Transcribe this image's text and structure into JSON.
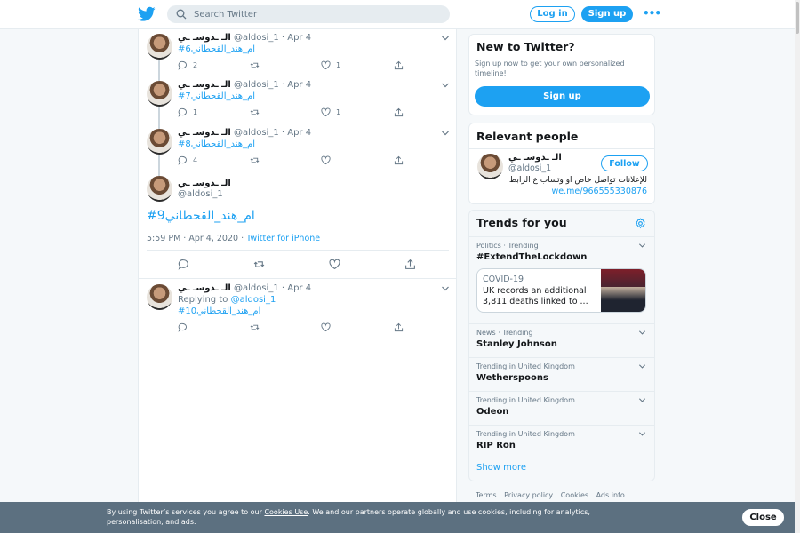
{
  "colors": {
    "brand": "#1da1f2",
    "text": "#14171a",
    "muted": "#657786",
    "border": "#e6ecf0",
    "cookie_bar": "#5c7080"
  },
  "nav": {
    "logo_icon": "twitter-bird-icon",
    "search_placeholder": "Search Twitter",
    "login_label": "Log in",
    "signup_label": "Sign up",
    "more_label": "•••"
  },
  "tweets": [
    {
      "name": "الـ ـدوسـ ـي",
      "handle": "@aldosi_1",
      "date": "Apr 4",
      "text": "#ام_هند_القحطاني6",
      "replies": "2",
      "retweets": "",
      "likes": "1"
    },
    {
      "name": "الـ ـدوسـ ـي",
      "handle": "@aldosi_1",
      "date": "Apr 4",
      "text": "#ام_هند_القحطاني7",
      "replies": "1",
      "retweets": "",
      "likes": "1"
    },
    {
      "name": "الـ ـدوسـ ـي",
      "handle": "@aldosi_1",
      "date": "Apr 4",
      "text": "#ام_هند_القحطاني8",
      "replies": "4",
      "retweets": "",
      "likes": ""
    }
  ],
  "main_tweet": {
    "name": "الـ ـدوسـ ـي",
    "handle": "@aldosi_1",
    "text": "#ام_هند_القحطاني9",
    "time": "5:59 PM · Apr 4, 2020",
    "source": "Twitter for iPhone"
  },
  "reply_tweet": {
    "name": "الـ ـدوسـ ـي",
    "handle": "@aldosi_1",
    "date": "Apr 4",
    "replying_prefix": "Replying to",
    "replying_to": "@aldosi_1",
    "text": "#ام_هند_القحطاني10"
  },
  "sidebar": {
    "new_to_twitter": {
      "title": "New to Twitter?",
      "subtitle": "Sign up now to get your own personalized timeline!",
      "button": "Sign up"
    },
    "relevant_people": {
      "title": "Relevant people",
      "name": "الـ ـدوسـ ـي",
      "handle": "@aldosi_1",
      "follow_label": "Follow",
      "bio": "للإعلانات تواصل خاص او وتساب ع الرابط",
      "link": "we.me/966555330876"
    },
    "trends": {
      "title": "Trends for you",
      "items": [
        {
          "context": "Politics · Trending",
          "name": "#ExtendTheLockdown"
        },
        {
          "context": "News · Trending",
          "name": "Stanley Johnson"
        },
        {
          "context": "Trending in United Kingdom",
          "name": "Wetherspoons"
        },
        {
          "context": "Trending in United Kingdom",
          "name": "Odeon"
        },
        {
          "context": "Trending in United Kingdom",
          "name": "RIP Ron"
        }
      ],
      "news": {
        "tag": "COVID-19",
        "text": "UK records an additional 3,811 deaths linked to ..."
      },
      "show_more": "Show more"
    },
    "footer_links": [
      "Terms",
      "Privacy policy",
      "Cookies",
      "Ads info"
    ]
  },
  "cookie_bar": {
    "text_before": "By using Twitter’s services you agree to our",
    "link": "Cookies Use",
    "text_after": ". We and our partners operate globally and use cookies, including for analytics, personalisation, and ads.",
    "close_label": "Close"
  }
}
